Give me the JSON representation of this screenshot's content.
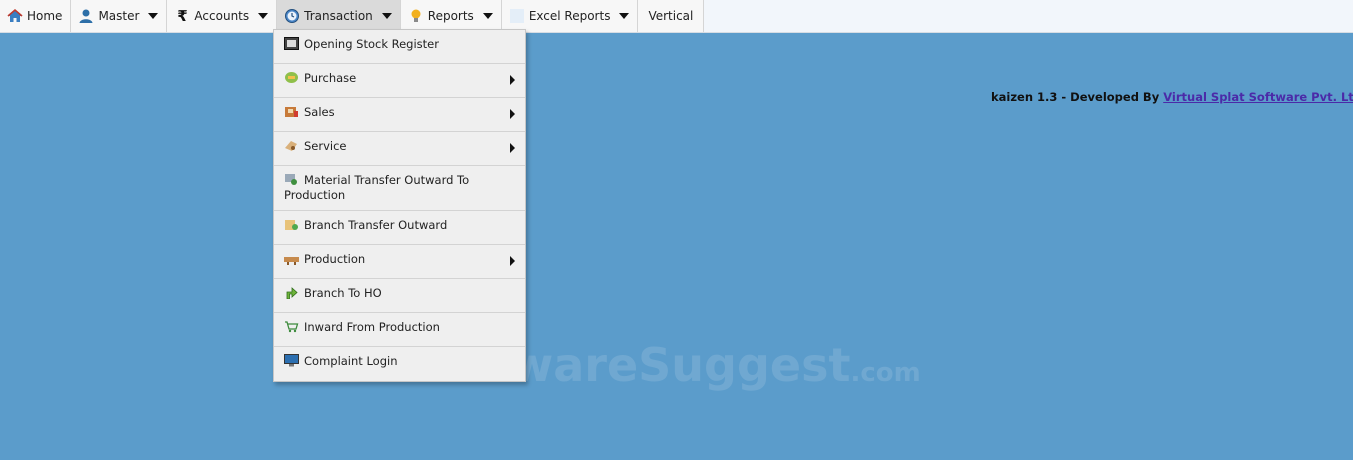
{
  "menubar": {
    "home": "Home",
    "master": "Master",
    "accounts": "Accounts",
    "transaction": "Transaction",
    "reports": "Reports",
    "excel_reports": "Excel Reports",
    "vertical": "Vertical"
  },
  "transaction_menu": [
    {
      "label": "Opening Stock Register",
      "icon": "register-icon",
      "submenu": false
    },
    {
      "label": "Purchase",
      "icon": "purchase-icon",
      "submenu": true
    },
    {
      "label": "Sales",
      "icon": "sales-icon",
      "submenu": true
    },
    {
      "label": "Service",
      "icon": "service-icon",
      "submenu": true
    },
    {
      "label": "Material Transfer Outward To Production",
      "icon": "material-transfer-icon",
      "submenu": false
    },
    {
      "label": "Branch Transfer Outward",
      "icon": "branch-transfer-icon",
      "submenu": false
    },
    {
      "label": "Production",
      "icon": "production-icon",
      "submenu": true
    },
    {
      "label": "Branch To HO",
      "icon": "branch-to-ho-icon",
      "submenu": false
    },
    {
      "label": "Inward From Production",
      "icon": "cart-icon",
      "submenu": false
    },
    {
      "label": "Complaint Login",
      "icon": "monitor-icon",
      "submenu": false
    }
  ],
  "credit": {
    "prefix": "kaizen 1.3 - Developed By",
    "link": "Virtual Splat Software Pvt. Lt"
  },
  "watermark": {
    "main": "SoftwareSuggest",
    "suffix": ".com"
  }
}
